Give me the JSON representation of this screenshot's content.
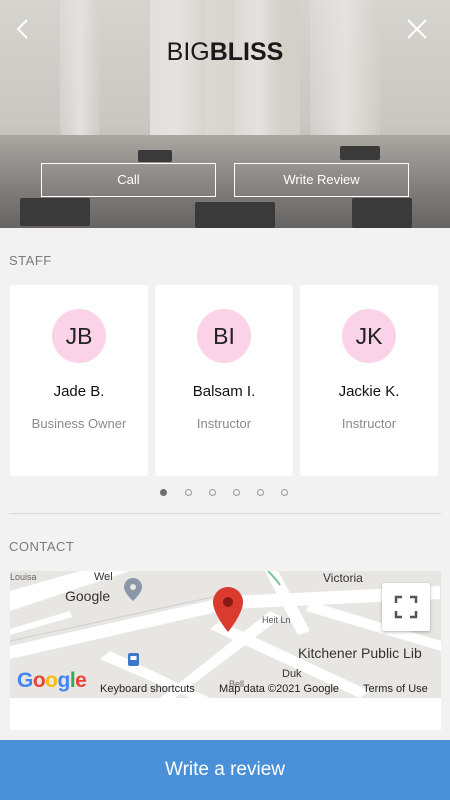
{
  "header": {
    "logo_thin": "BIG",
    "logo_bold": "BLISS",
    "back_icon": "chevron-left-icon",
    "close_icon": "close-icon",
    "call_label": "Call",
    "write_review_label": "Write Review"
  },
  "staff": {
    "section_title": "STAFF",
    "members": [
      {
        "initials": "JB",
        "name": "Jade B.",
        "role": "Business Owner"
      },
      {
        "initials": "BI",
        "name": "Balsam I.",
        "role": "Instructor"
      },
      {
        "initials": "JK",
        "name": "Jackie K.",
        "role": "Instructor"
      }
    ],
    "pager": {
      "count": 6,
      "active_index": 0
    },
    "avatar_color": "#fbd3e9"
  },
  "contact": {
    "section_title": "CONTACT",
    "map": {
      "labels": {
        "google_place": "Google",
        "victoria": "Victoria",
        "heit": "Heit Ln",
        "library": "Kitchener Public Lib",
        "wel": "Wel",
        "louisa": "Louisa",
        "duk": "Duk",
        "bell": "Bell"
      },
      "footer": {
        "google_logo": "Google",
        "shortcuts": "Keyboard shortcuts",
        "map_data": "Map data ©2021 Google",
        "terms": "Terms of Use"
      },
      "fullscreen_icon": "fullscreen-icon",
      "pin_icon": "map-pin-icon",
      "pin_color": "#db3a2f"
    }
  },
  "footer": {
    "cta_label": "Write a review",
    "cta_color": "#4a90d9"
  }
}
